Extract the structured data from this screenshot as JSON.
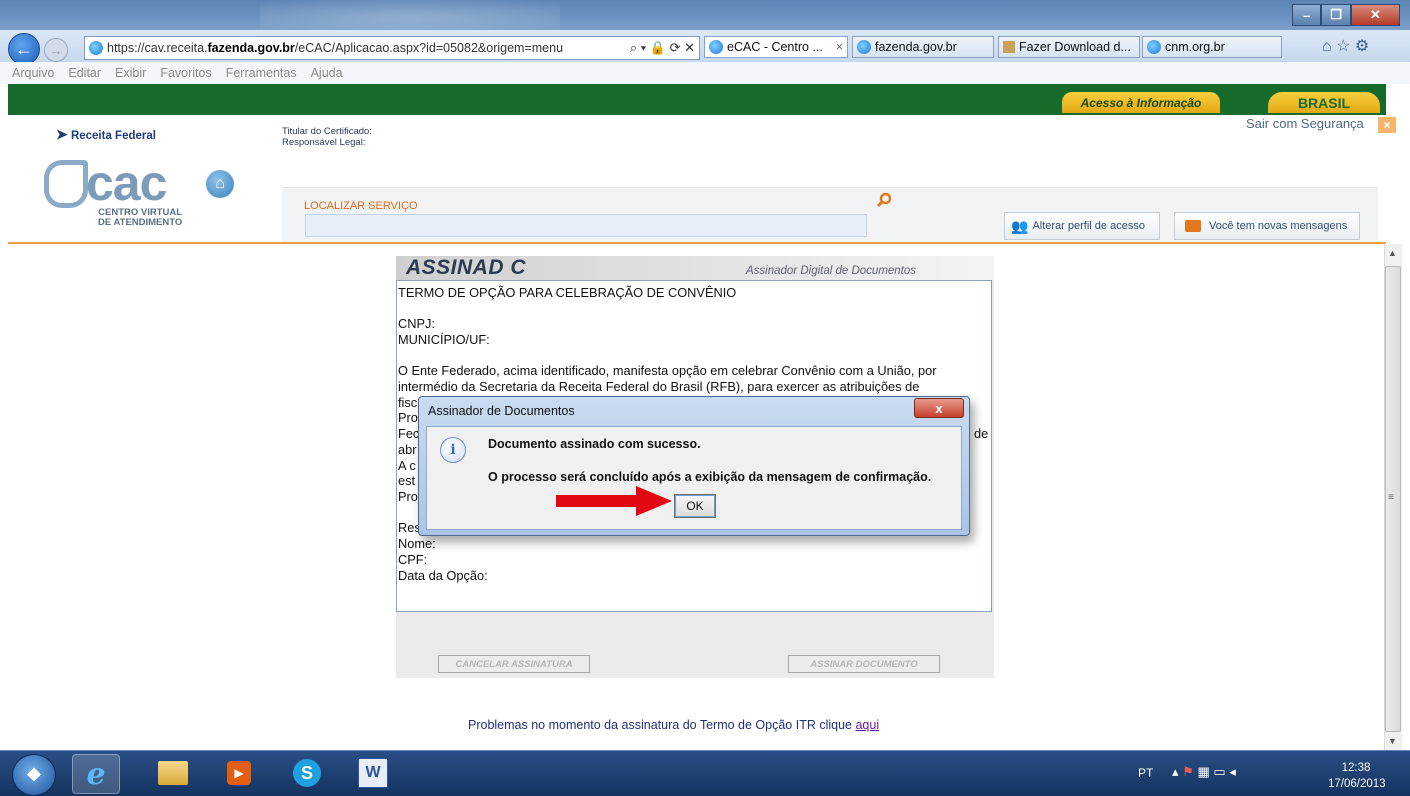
{
  "browser": {
    "url_host": "https://cav.receita.",
    "url_bold": "fazenda.gov.br",
    "url_rest": "/eCAC/Aplicacao.aspx?id=05082&origem=menu",
    "tabs": [
      {
        "label": "eCAC - Centro ..."
      },
      {
        "label": "fazenda.gov.br"
      },
      {
        "label": "Fazer Download d..."
      },
      {
        "label": "cnm.org.br"
      }
    ],
    "menu": [
      "Arquivo",
      "Editar",
      "Exibir",
      "Favoritos",
      "Ferramentas",
      "Ajuda"
    ]
  },
  "portal": {
    "acesso": "Acesso à Informação",
    "brasil": "BRASIL"
  },
  "header": {
    "sair": "Sair com Segurança",
    "rf_logo": "Receita Federal",
    "titular": "Titular do Certificado:",
    "responsavel": "Responsável Legal:",
    "ecac": "ecac",
    "ecac_sub1": "CENTRO VIRTUAL",
    "ecac_sub2": "DE ATENDIMENTO",
    "localizar": "LOCALIZAR SERVIÇO",
    "alterar_perfil": "Alterar perfil de acesso",
    "mensagens": "Você tem novas mensagens"
  },
  "assinador": {
    "logo": "ASSINAD C",
    "subtitle": "Assinador Digital de Documentos",
    "doc_lines": [
      "TERMO DE OPÇÃO PARA CELEBRAÇÃO DE CONVÊNIO",
      "CNPJ:",
      "MUNICÍPIO/UF:",
      "O Ente Federado, acima identificado, manifesta opção em celebrar Convênio com a União, por",
      "intermédio da Secretaria da Receita Federal do Brasil (RFB), para exercer as atribuições de",
      "fisc",
      "Pro",
      "Fec",
      "abr",
      "A c",
      "est",
      "Pro",
      "Res",
      "Nome:",
      "CPF:",
      "Data da Opção:"
    ],
    "doc_trailing_de": "de",
    "cancelar": "CANCELAR ASSINATURA",
    "assinar": "ASSINAR DOCUMENTO",
    "problemas": "Problemas no momento da assinatura do Termo de Opção ITR clique",
    "aqui": "aqui"
  },
  "dialog": {
    "title": "Assinador de Documentos",
    "close": "x",
    "message1": "Documento assinado com sucesso.",
    "message2": "O processo será concluído após a exibição da mensagem de confirmação.",
    "ok": "OK",
    "info_glyph": "i"
  },
  "taskbar": {
    "lang": "PT",
    "time": "12:38",
    "date": "17/06/2013"
  },
  "colors": {
    "green_bar": "#166b2a",
    "accent_orange": "#f0a044",
    "arrow_red": "#e30613"
  }
}
